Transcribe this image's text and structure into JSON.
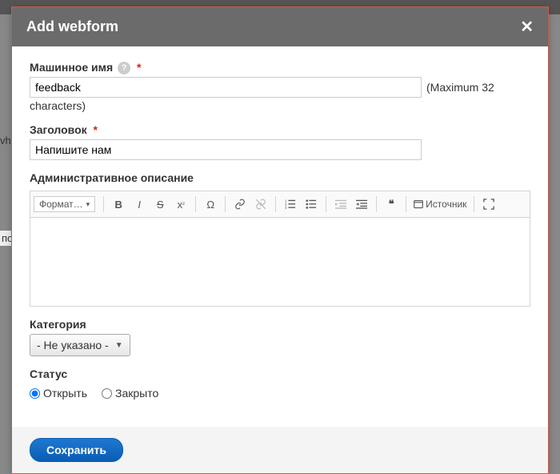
{
  "bg": {
    "left1": "vhi",
    "left2": "по"
  },
  "modal": {
    "title": "Add webform",
    "machine_name": {
      "label": "Машинное имя",
      "value": "feedback",
      "hint_inline": "(Maximum 32",
      "hint_below": "characters)"
    },
    "title_field": {
      "label": "Заголовок",
      "value": "Напишите нам"
    },
    "description": {
      "label": "Административное описание",
      "format_label": "Формат…",
      "source_label": "Источник"
    },
    "category": {
      "label": "Категория",
      "selected": "- Не указано -"
    },
    "status": {
      "label": "Статус",
      "options": [
        "Открыть",
        "Закрыто"
      ],
      "selected": "Открыть"
    },
    "save_label": "Сохранить"
  }
}
